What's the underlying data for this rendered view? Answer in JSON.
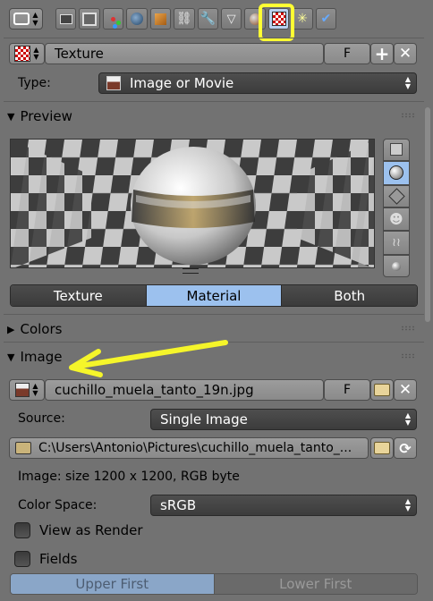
{
  "properties_tabs": [
    "render-icon",
    "render-layers-icon",
    "scene-icon",
    "world-icon",
    "object-icon",
    "constraints-icon",
    "modifiers-icon",
    "data-icon",
    "material-icon",
    "texture-icon",
    "particles-icon",
    "physics-icon"
  ],
  "texture_block": {
    "name": "Texture",
    "fake_user": "F"
  },
  "type_row": {
    "label": "Type:",
    "value": "Image or Movie"
  },
  "preview": {
    "title": "Preview",
    "tabs": [
      "Texture",
      "Material",
      "Both"
    ],
    "active_tab": "Material"
  },
  "colors": {
    "title": "Colors"
  },
  "image": {
    "title": "Image",
    "filename": "cuchillo_muela_tanto_19n.jpg",
    "fake_user": "F",
    "source_label": "Source:",
    "source_value": "Single Image",
    "filepath": "C:\\Users\\Antonio\\Pictures\\cuchillo_muela_tanto_...",
    "info": "Image: size 1200 x 1200, RGB byte",
    "color_space_label": "Color Space:",
    "color_space_value": "sRGB",
    "view_as_render": "View as Render",
    "fields": "Fields",
    "upper_first": "Upper First",
    "lower_first": "Lower First"
  },
  "colors_accent": {
    "highlight": "#ffff33",
    "active_blue": "#9cc1ee",
    "arrow": "#f5f52a"
  }
}
